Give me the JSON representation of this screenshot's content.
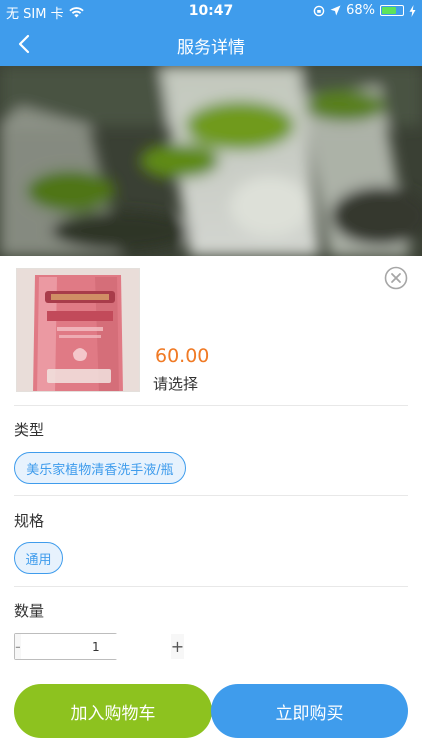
{
  "status_bar": {
    "carrier": "无 SIM 卡",
    "time": "10:47",
    "battery": "68%",
    "battery_level": 0.68
  },
  "nav": {
    "title": "服务详情",
    "back_icon": "chevron-left-icon"
  },
  "product": {
    "price": "60.00",
    "selection_prompt": "请选择",
    "close_icon": "close-circle-icon"
  },
  "options": {
    "type_label": "类型",
    "type_value": "美乐家植物清香洗手液/瓶",
    "spec_label": "规格",
    "spec_value": "通用",
    "quantity_label": "数量",
    "quantity_value": "1",
    "minus_symbol": "-",
    "plus_symbol": "+"
  },
  "actions": {
    "add_to_cart": "加入购物车",
    "buy_now": "立即购买"
  },
  "colors": {
    "primary": "#3f9cec",
    "price": "#f07a25",
    "cart": "#8dc21f"
  }
}
